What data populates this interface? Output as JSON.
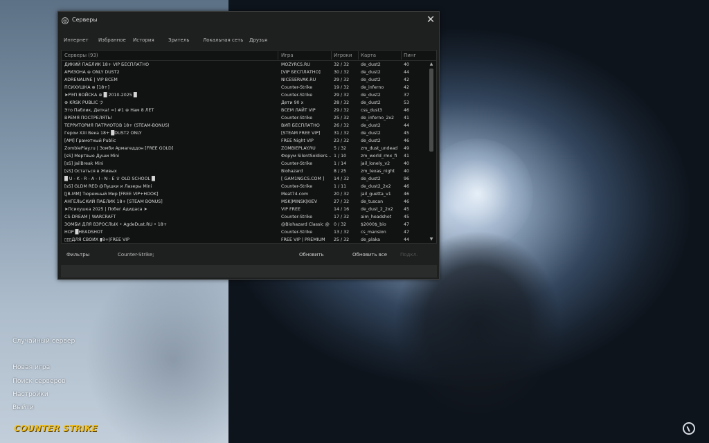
{
  "window": {
    "title": "Серверы",
    "close_glyph": "✕"
  },
  "tabs": [
    "Интернет",
    "Избранное",
    "История",
    "Зритель",
    "Локальная сеть",
    "Друзья"
  ],
  "columns": {
    "servers": "Серверы (93)",
    "game": "Игра",
    "players": "Игроки",
    "map": "Карта",
    "ping": "Пинг"
  },
  "servers": [
    {
      "name": "ДИКИЙ ПАБЛИК 18+ VIP БЕСПЛАТНО",
      "game": "MOZYRCS.RU",
      "players": "32 / 32",
      "map": "de_dust2",
      "ping": "40"
    },
    {
      "name": "АРИЗОНА ⊕ ONLY DUST2",
      "game": "[VIP БЕСПЛАТНО]",
      "players": "30 / 32",
      "map": "de_dust2",
      "ping": "44"
    },
    {
      "name": "ADRENALINE | VIP ВСЕМ",
      "game": "NICESERVAK.RU",
      "players": "29 / 32",
      "map": "de_dust2",
      "ping": "42"
    },
    {
      "name": "ПСИХУШКА ⊕ [18+]",
      "game": "Counter-Strike",
      "players": "19 / 32",
      "map": "de_inferno",
      "ping": "42"
    },
    {
      "name": "➤РЭП ВОЙСКА ⊕ █ 2010-2025 █",
      "game": "Counter-Strike",
      "players": "29 / 32",
      "map": "de_dust2",
      "ping": "37"
    },
    {
      "name": "⊕ KRSK PUBLIC ツ",
      "game": "Дети 90 х",
      "players": "28 / 32",
      "map": "de_dust2",
      "ping": "53"
    },
    {
      "name": "Это Паблик, Детка! =) #1 ⊕ Нам 8 ЛЕТ",
      "game": "ВСЕМ ЛАЙТ VIP",
      "players": "29 / 32",
      "map": "css_dust3",
      "ping": "46"
    },
    {
      "name": "ВРЕМЯ ПОСТРЕЛЯТЬ!",
      "game": "Counter-Strike",
      "players": "25 / 32",
      "map": "de_inferno_2x2",
      "ping": "41"
    },
    {
      "name": "ТЕРРИТОРИЯ ПАТРИОТОВ 18+ (STEAM-BONUS)",
      "game": "ВИП БЕСПЛАТНО",
      "players": "26 / 32",
      "map": "de_dust2",
      "ping": "44"
    },
    {
      "name": "Герои XXI Века 18+ █DUST2 ONLY",
      "game": "[STEAM FREE VIP]",
      "players": "31 / 32",
      "map": "de_dust2",
      "ping": "45"
    },
    {
      "name": "[AM] Грамотный Public",
      "game": "FREE Night VIP",
      "players": "23 / 32",
      "map": "de_dust2",
      "ping": "46"
    },
    {
      "name": "ZombiePlay.ru | Зомби Армагеддон [FREE GOLD]",
      "game": "ZOMBIEPLAY.RU",
      "players": "5 / 32",
      "map": "zm_dust_undead",
      "ping": "49"
    },
    {
      "name": "[sS] Мертвые Души Mini",
      "game": "Форум SilentSoldiers...",
      "players": "1 / 10",
      "map": "zm_world_rmx_fi",
      "ping": "41"
    },
    {
      "name": "[sS] JailBreak Mini",
      "game": "Counter-Strike",
      "players": "1 / 14",
      "map": "jail_lonely_v2",
      "ping": "40"
    },
    {
      "name": "[sS] Остаться в Живых",
      "game": "Biohazard",
      "players": "8 / 25",
      "map": "zm_texas_night",
      "ping": "40"
    },
    {
      "name": "█ U - K - R - A - I - N - E ♕ OLD SCHOOL █",
      "game": "[ GAM1NGCS.COM ]",
      "players": "14 / 32",
      "map": "de_dust2",
      "ping": "96"
    },
    {
      "name": "[sS] GLDM RED @Пушки и Лазеры Mini",
      "game": "Counter-Strike",
      "players": "1 / 11",
      "map": "de_dust2_2x2",
      "ping": "46"
    },
    {
      "name": "[JB-MM] Тюремный Мир [FREE VIP+HOOK]",
      "game": "Meat74.com",
      "players": "20 / 32",
      "map": "jail_guetta_v1",
      "ping": "46"
    },
    {
      "name": "АНГЕЛЬСКИЙ ПАБЛИК 18+ [STEAM BONUS]",
      "game": "MSK|MINSK|KIEV",
      "players": "27 / 32",
      "map": "de_tuscan",
      "ping": "46"
    },
    {
      "name": "➤Психушка 2025 | Побег Адидаса ➤",
      "game": "VIP FREE",
      "players": "14 / 16",
      "map": "de_dust_2_2x2",
      "ping": "45"
    },
    {
      "name": "CS-DREAM | WARCRAFT",
      "game": "Counter-Strike",
      "players": "17 / 32",
      "map": "aim_headshot",
      "ping": "45"
    },
    {
      "name": "ЗОМБИ ДЛЯ ВЗРОСЛЫХ • AgdeDust.RU • 18+",
      "game": "@Biohazard Classic @",
      "players": "0 / 32",
      "map": "$2000$_bio",
      "ping": "47"
    },
    {
      "name": "HOP █HEADSHOT",
      "game": "Counter-Strike",
      "players": "13 / 32",
      "map": "cs_mansion",
      "ping": "47"
    },
    {
      "name": "▯▯▯ДЛЯ СВОИХ ▮8+|FREE VIP",
      "game": "FREE VIP | PREMIUM",
      "players": "25 / 32",
      "map": "de_plaka",
      "ping": "44"
    }
  ],
  "bottom": {
    "filters": "Фильтры",
    "filter_value": "Counter-Strike;",
    "refresh": "Обновить",
    "refresh_all": "Обновить все",
    "connect": "Подкл."
  },
  "menu": {
    "random_server": "Случайный сервер",
    "new_game": "Новая игра",
    "find_servers": "Поиск серверов",
    "settings": "Настройки",
    "quit": "Выйти"
  },
  "logo_text": "COUNTER STRIKE",
  "colors": {
    "window_bg": "#1e1f1f",
    "list_bg": "#111212",
    "logo": "#f0c020"
  },
  "icons": {
    "window": "steam-cs-icon",
    "corner": "cs-logo-icon"
  }
}
